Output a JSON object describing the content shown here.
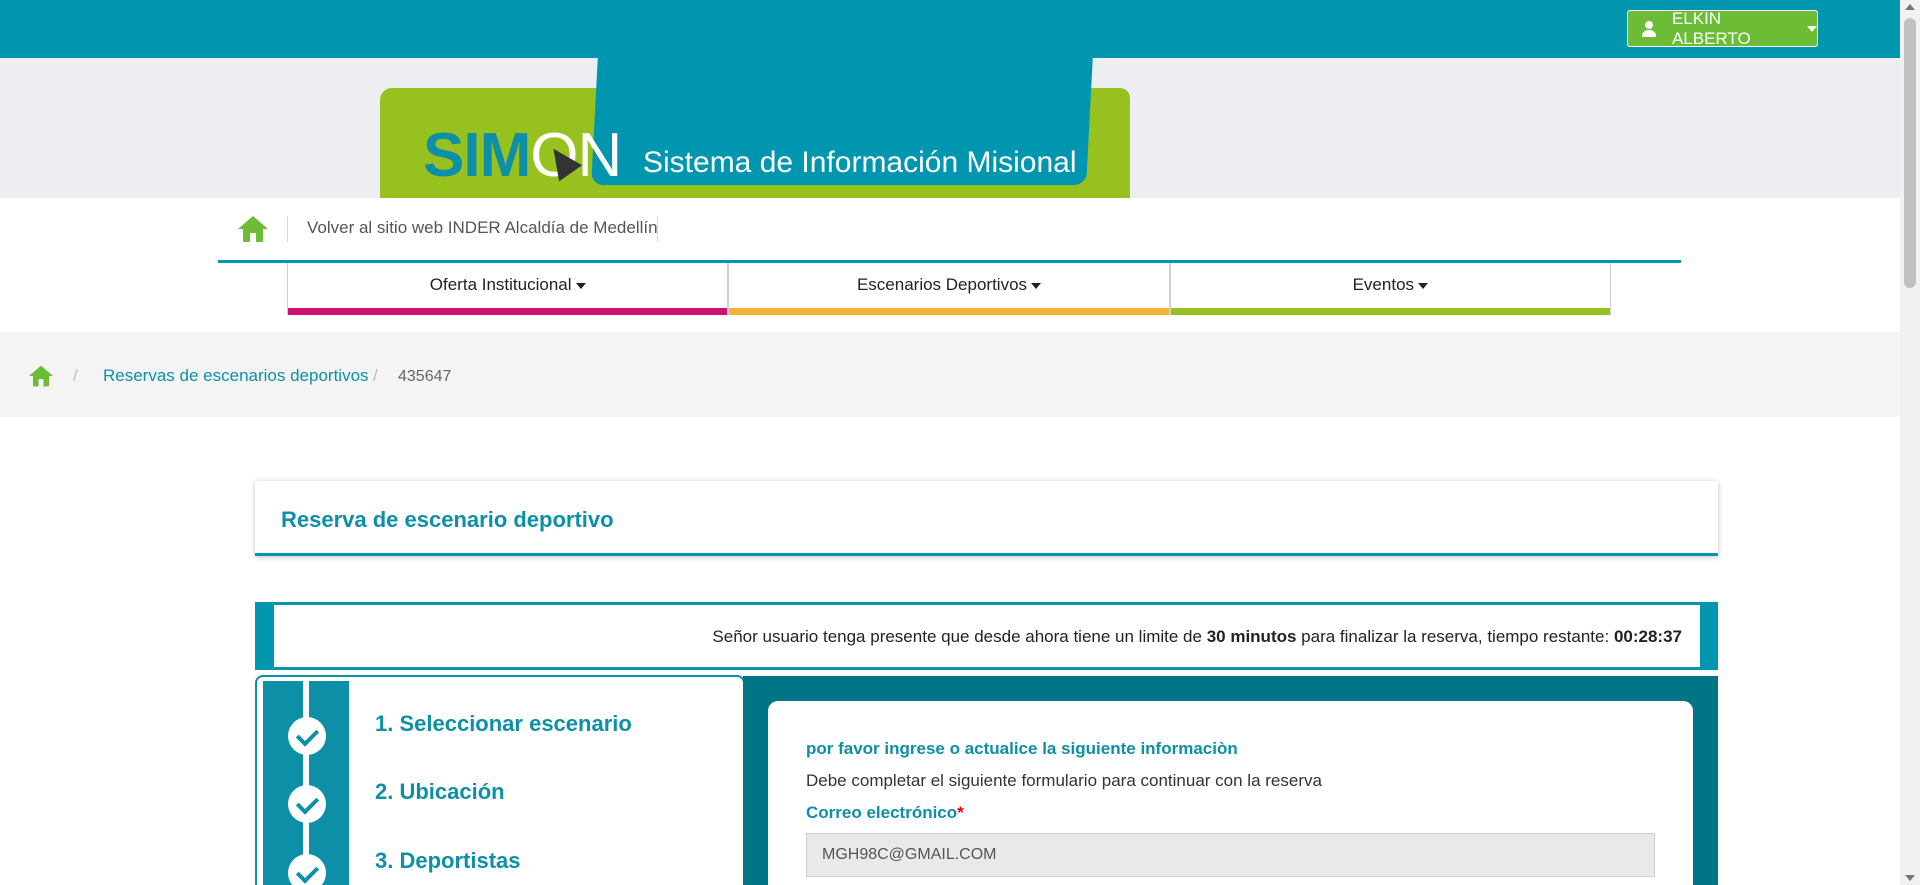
{
  "header": {
    "user_name": "ELKIN ALBERTO"
  },
  "banner": {
    "logo_sim": "SIM",
    "logo_on": "ON",
    "subtitle": "Sistema de Información Misional"
  },
  "nav": {
    "back_link": "Volver al sitio web INDER Alcaldía de Medellín",
    "menu": [
      {
        "label": "Oferta Institucional",
        "color": "#d0106e"
      },
      {
        "label": "Escenarios Deportivos",
        "color": "#f5b335"
      },
      {
        "label": "Eventos",
        "color": "#97c11f"
      }
    ]
  },
  "breadcrumb": {
    "items": [
      "Reservas de escenarios deportivos",
      "435647"
    ]
  },
  "page": {
    "title": "Reserva de escenario deportivo"
  },
  "notice": {
    "text_before": "Señor usuario tenga presente que desde ahora tiene un limite de ",
    "limit": "30 minutos",
    "text_middle": " para finalizar la reserva, tiempo restante: ",
    "remaining": "00:28:37"
  },
  "steps": [
    {
      "label": "1. Seleccionar escenario"
    },
    {
      "label": "2. Ubicación"
    },
    {
      "label": "3. Deportistas"
    }
  ],
  "form": {
    "title": "por favor ingrese o actualice la siguiente informaciòn",
    "subtitle": "Debe completar el siguiente formulario para continuar con la reserva",
    "email_label": "Correo electrónico",
    "required_mark": "*",
    "email_value": "MGH98C@GMAIL.COM"
  },
  "colors": {
    "primary": "#0096b0",
    "green": "#6cbd35",
    "pink": "#d0106e",
    "orange": "#f5b335",
    "lime": "#97c11f"
  }
}
